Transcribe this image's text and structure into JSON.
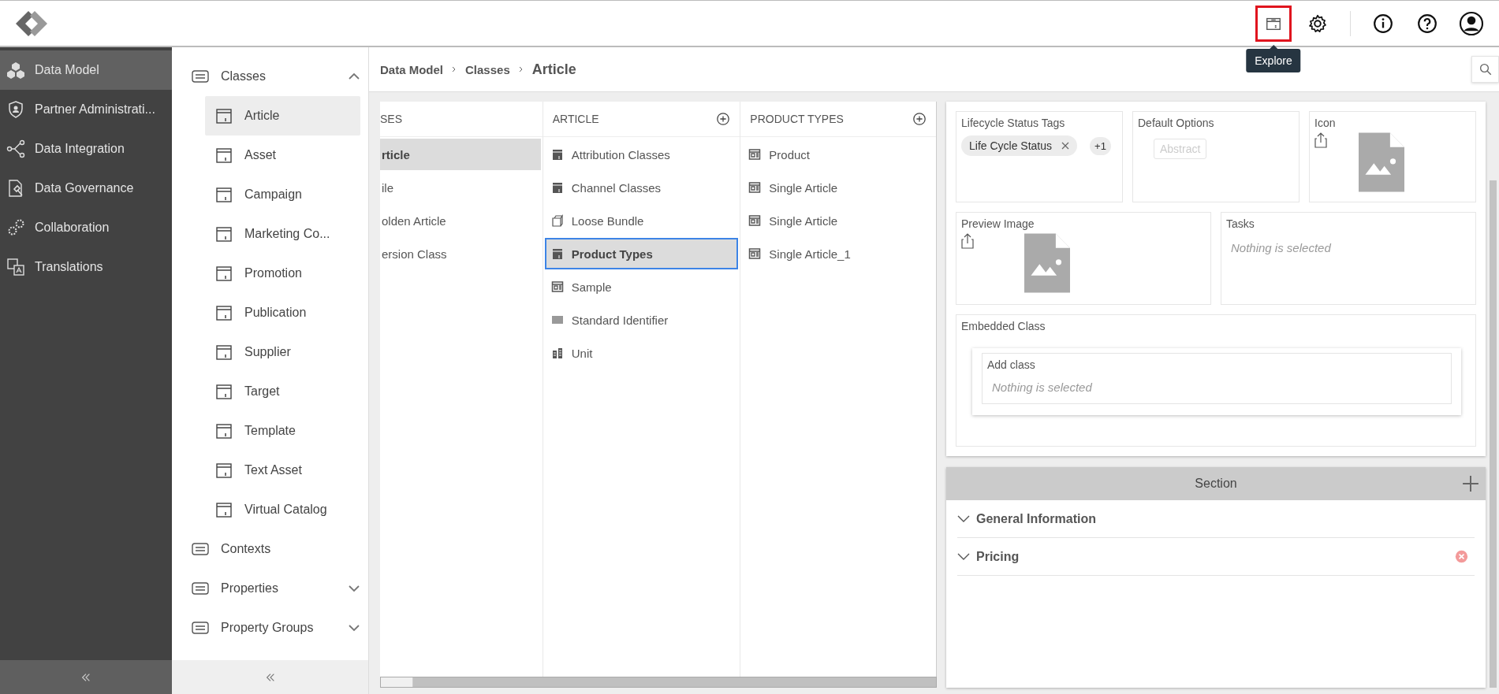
{
  "topbar": {
    "actions": [
      {
        "kind": "explore",
        "highlighted": true,
        "tooltip": "Explore"
      },
      {
        "kind": "settings",
        "highlighted": false
      },
      {
        "kind": "info",
        "highlighted": false
      },
      {
        "kind": "help",
        "highlighted": false
      },
      {
        "kind": "account",
        "highlighted": false
      }
    ]
  },
  "nav": {
    "items": [
      {
        "kind": "model",
        "label": "Data Model",
        "selected": true
      },
      {
        "kind": "partner",
        "label": "Partner Administrati...",
        "selected": false
      },
      {
        "kind": "integration",
        "label": "Data Integration",
        "selected": false
      },
      {
        "kind": "governance",
        "label": "Data Governance",
        "selected": false
      },
      {
        "kind": "collaboration",
        "label": "Collaboration",
        "selected": false
      },
      {
        "kind": "translation",
        "label": "Translations",
        "selected": false
      }
    ]
  },
  "subnav": {
    "sections": [
      {
        "label": "Classes",
        "expanded": true,
        "children": [
          {
            "label": "Article",
            "selected": true
          },
          {
            "label": "Asset",
            "selected": false
          },
          {
            "label": "Campaign",
            "selected": false
          },
          {
            "label": "Marketing Co...",
            "selected": false
          },
          {
            "label": "Promotion",
            "selected": false
          },
          {
            "label": "Publication",
            "selected": false
          },
          {
            "label": "Supplier",
            "selected": false
          },
          {
            "label": "Target",
            "selected": false
          },
          {
            "label": "Template",
            "selected": false
          },
          {
            "label": "Text Asset",
            "selected": false
          },
          {
            "label": "Virtual Catalog",
            "selected": false
          }
        ]
      },
      {
        "label": "Contexts"
      },
      {
        "label": "Properties",
        "expanded": false
      },
      {
        "label": "Property Groups",
        "expanded": false
      }
    ]
  },
  "breadcrumb": [
    "Data Model",
    "Classes",
    "Article"
  ],
  "columns": [
    {
      "header": "SES",
      "addable": false,
      "items": [
        {
          "label": "rticle",
          "selected": true,
          "focused": false
        },
        {
          "label": "ile",
          "selected": false,
          "focused": false
        },
        {
          "label": "olden Article",
          "selected": false,
          "focused": false
        },
        {
          "label": "ersion Class",
          "selected": false,
          "focused": false
        }
      ]
    },
    {
      "header": "ARTICLE",
      "addable": true,
      "items": [
        {
          "kind": "class",
          "label": "Attribution Classes",
          "selected": false,
          "focused": false
        },
        {
          "kind": "class",
          "label": "Channel Classes",
          "selected": false,
          "focused": false
        },
        {
          "kind": "bundle",
          "label": "Loose Bundle",
          "selected": false,
          "focused": false
        },
        {
          "kind": "class",
          "label": "Product Types",
          "selected": true,
          "focused": true
        },
        {
          "kind": "type",
          "label": "Sample",
          "selected": false,
          "focused": false
        },
        {
          "kind": "identifier",
          "label": "Standard Identifier",
          "selected": false,
          "focused": false
        },
        {
          "kind": "unit",
          "label": "Unit",
          "selected": false,
          "focused": false
        }
      ]
    },
    {
      "header": "PRODUCT TYPES",
      "addable": true,
      "items": [
        {
          "kind": "type",
          "label": "Product",
          "selected": false,
          "focused": false
        },
        {
          "kind": "type",
          "label": "Single Article",
          "selected": false,
          "focused": false
        },
        {
          "kind": "type",
          "label": "Single Article",
          "selected": false,
          "focused": false
        },
        {
          "kind": "type",
          "label": "Single Article_1",
          "selected": false,
          "focused": false
        }
      ]
    }
  ],
  "details": {
    "lifecycle": {
      "label": "Lifecycle Status Tags",
      "tags": [
        "Life Cycle Status"
      ],
      "more": "+1"
    },
    "default_options": {
      "label": "Default Options",
      "options": [
        {
          "label": "Abstract",
          "disabled": true
        }
      ]
    },
    "icon": {
      "label": "Icon"
    },
    "preview_image": {
      "label": "Preview Image"
    },
    "tasks": {
      "label": "Tasks",
      "placeholder": "Nothing is selected"
    },
    "embedded_class": {
      "label": "Embedded Class",
      "field": {
        "label": "Add class",
        "placeholder": "Nothing is selected"
      }
    }
  },
  "section_panel": {
    "title": "Section",
    "rows": [
      {
        "label": "General Information",
        "removable": false
      },
      {
        "label": "Pricing",
        "removable": true
      }
    ]
  }
}
